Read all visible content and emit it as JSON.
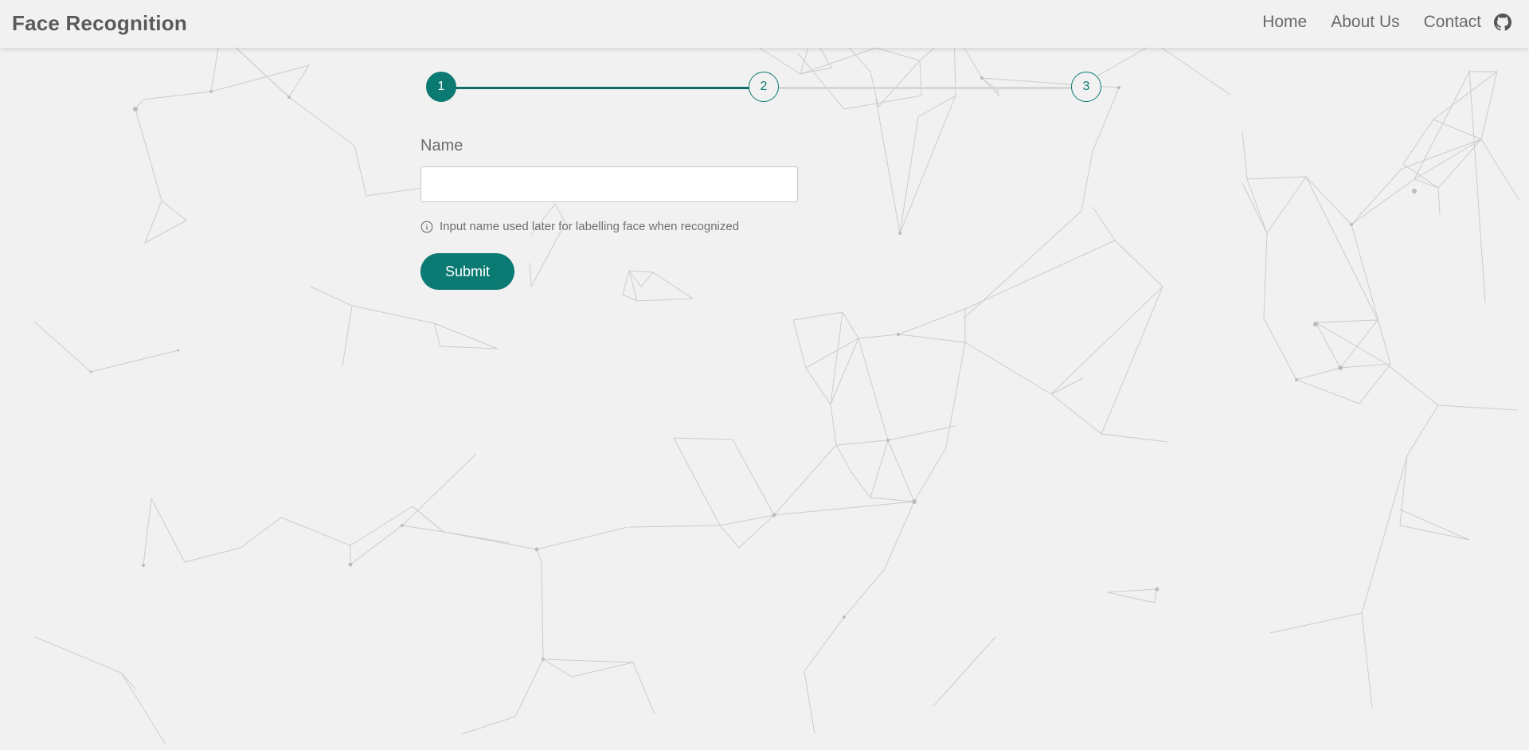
{
  "navbar": {
    "brand": "Face Recognition",
    "links": [
      {
        "label": "Home"
      },
      {
        "label": "About Us"
      },
      {
        "label": "Contact"
      }
    ],
    "github_icon": "github-icon"
  },
  "stepper": {
    "steps": [
      {
        "label": "1",
        "state": "active"
      },
      {
        "label": "2",
        "state": "pending"
      },
      {
        "label": "3",
        "state": "pending"
      }
    ],
    "current_step": 1,
    "total_steps": 3
  },
  "form": {
    "name_label": "Name",
    "name_value": "",
    "name_placeholder": "",
    "hint_icon": "info-icon",
    "hint": "Input name used later for labelling face when recognized",
    "submit_label": "Submit"
  },
  "colors": {
    "accent": "#0b7a72",
    "background": "#f1f1f1",
    "text_muted": "#6b6b6b",
    "track": "#d6d6d6"
  },
  "background": {
    "decoration": "network-graph-pattern"
  }
}
